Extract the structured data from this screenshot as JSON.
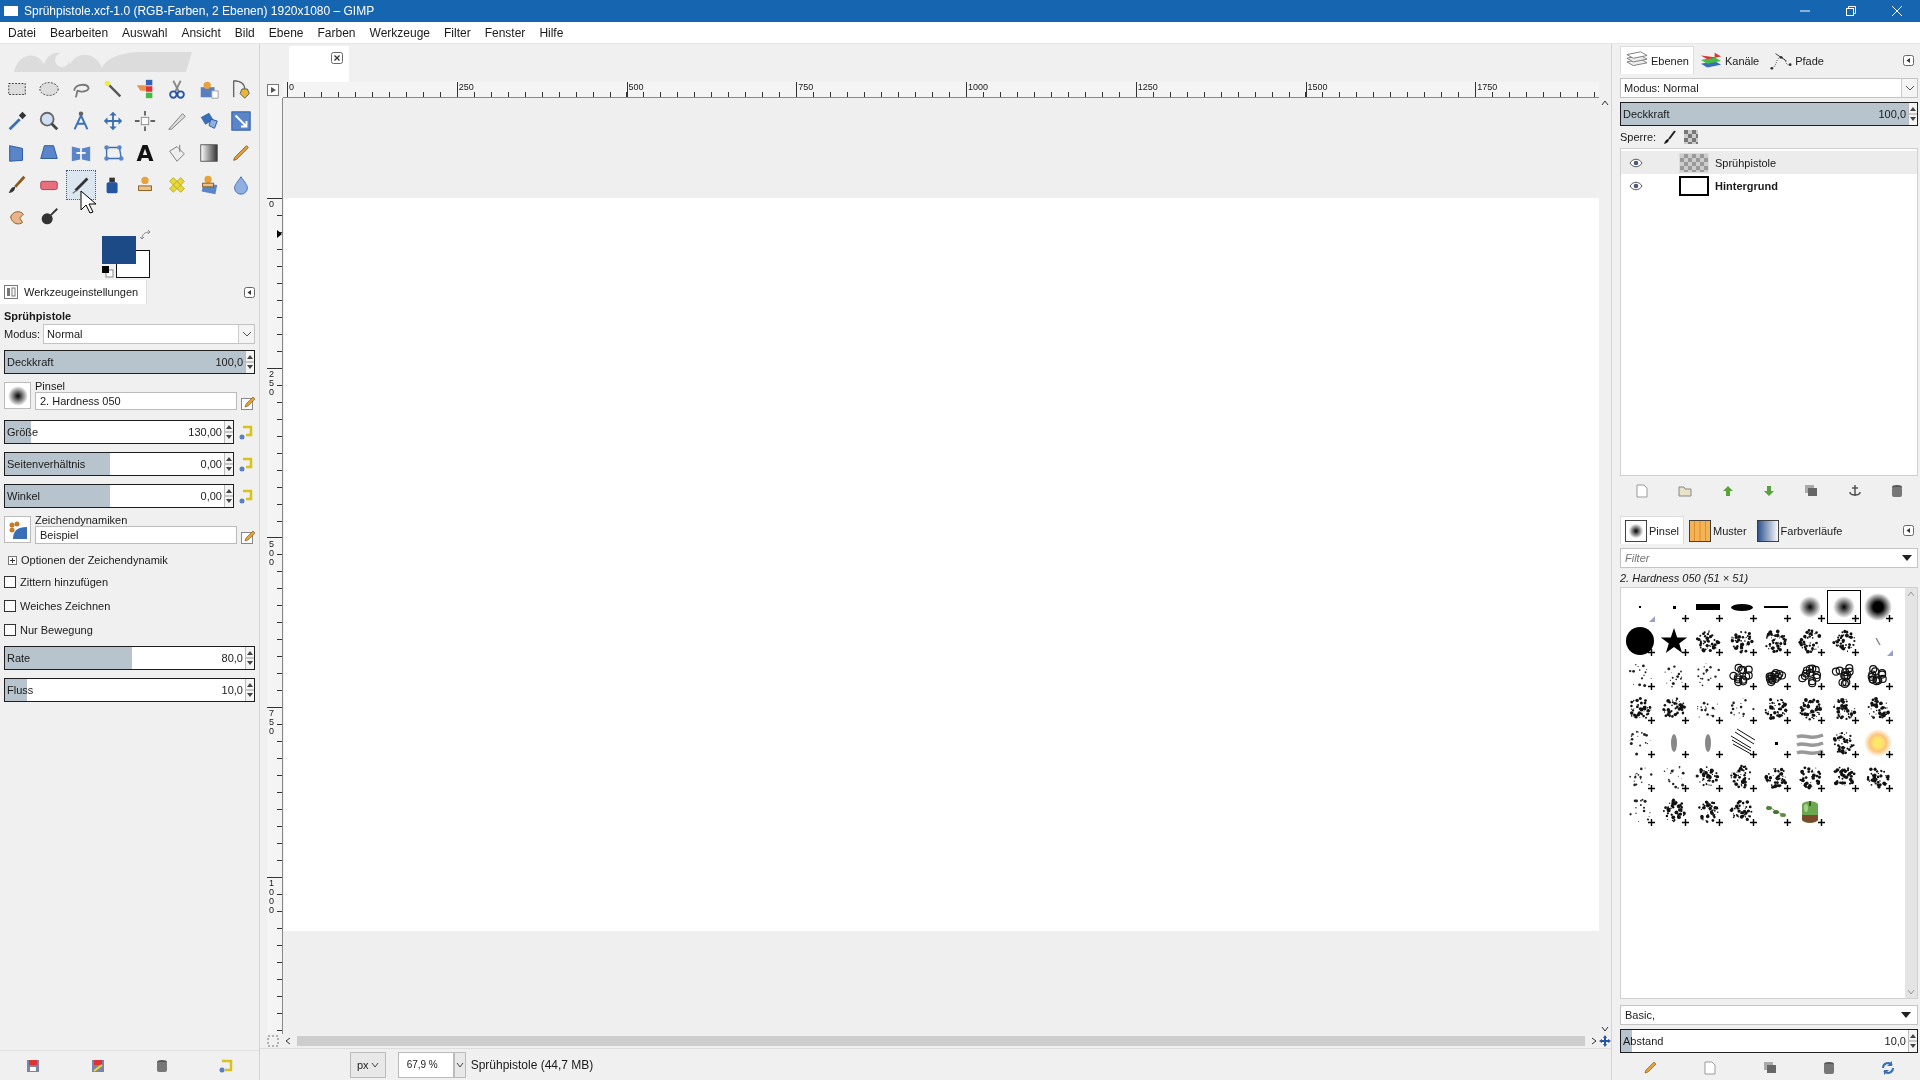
{
  "window": {
    "title": "Sprühpistole.xcf-1.0 (RGB-Farben, 2 Ebenen) 1920x1080 – GIMP"
  },
  "menu": [
    "Datei",
    "Bearbeiten",
    "Auswahl",
    "Ansicht",
    "Bild",
    "Ebene",
    "Farben",
    "Werkzeuge",
    "Filter",
    "Fenster",
    "Hilfe"
  ],
  "toolbox": {
    "tools": [
      {
        "kind": "rect_select",
        "selected": false
      },
      {
        "kind": "ellipse_select",
        "selected": false
      },
      {
        "kind": "lasso",
        "selected": false
      },
      {
        "kind": "wand",
        "selected": false
      },
      {
        "kind": "color_select",
        "selected": false
      },
      {
        "kind": "scissors",
        "selected": false
      },
      {
        "kind": "foreground_select",
        "selected": false
      },
      {
        "kind": "paths",
        "selected": false
      },
      {
        "kind": "eyedropper",
        "selected": false
      },
      {
        "kind": "zoom",
        "selected": false
      },
      {
        "kind": "measure",
        "selected": false
      },
      {
        "kind": "move",
        "selected": false
      },
      {
        "kind": "align",
        "selected": false
      },
      {
        "kind": "knife",
        "selected": false
      },
      {
        "kind": "transform",
        "selected": false
      },
      {
        "kind": "handle_transform",
        "selected": false
      },
      {
        "kind": "perspective",
        "selected": false
      },
      {
        "kind": "warp",
        "selected": false
      },
      {
        "kind": "flip",
        "selected": false
      },
      {
        "kind": "cage",
        "selected": false
      },
      {
        "kind": "text",
        "label": "A",
        "selected": false
      },
      {
        "kind": "bucket",
        "selected": false
      },
      {
        "kind": "gradient",
        "selected": false
      },
      {
        "kind": "pencil",
        "selected": false
      },
      {
        "kind": "paintbrush",
        "selected": false
      },
      {
        "kind": "eraser",
        "selected": false
      },
      {
        "kind": "airbrush",
        "selected": true
      },
      {
        "kind": "ink",
        "selected": false
      },
      {
        "kind": "clone",
        "selected": false
      },
      {
        "kind": "heal",
        "selected": false
      },
      {
        "kind": "perspective_clone",
        "selected": false
      },
      {
        "kind": "blur",
        "selected": false
      },
      {
        "kind": "smudge",
        "selected": false
      },
      {
        "kind": "dodge_burn",
        "selected": false
      }
    ]
  },
  "tool_options": {
    "tab": "Werkzeugeinstellungen",
    "tool": "Sprühpistole",
    "mode_label": "Modus:",
    "mode": "Normal",
    "opacity": {
      "label": "Deckkraft",
      "value": "100,0",
      "level": 1
    },
    "brush": {
      "label": "Pinsel",
      "value": "2. Hardness 050"
    },
    "sliders": [
      {
        "label": "Größe",
        "value": "130,00",
        "level": 0.12
      },
      {
        "label": "Seitenverhältnis",
        "value": "0,00",
        "level": 0.48
      },
      {
        "label": "Winkel",
        "value": "0,00",
        "level": 0.48
      }
    ],
    "dynamics": {
      "label": "Zeichendynamiken",
      "value": "Beispiel"
    },
    "dynamics_options": {
      "label": "Optionen der Zeichendynamik",
      "expanded": false
    },
    "checkboxes": [
      {
        "label": "Zittern hinzufügen",
        "checked": false
      },
      {
        "label": "Weiches Zeichnen",
        "checked": false
      },
      {
        "label": "Nur Bewegung",
        "checked": false
      }
    ],
    "rate_sliders": [
      {
        "label": "Rate",
        "value": "80,0",
        "level": 0.53
      },
      {
        "label": "Fluss",
        "value": "10,0",
        "level": 0.09
      }
    ]
  },
  "rulers": {
    "horizontal": [
      "0",
      "250",
      "500",
      "750",
      "1000",
      "1250",
      "1500",
      "1750"
    ],
    "vertical": [
      "0",
      "250",
      "500",
      "750",
      "1000"
    ]
  },
  "status_bar": {
    "unit": "px",
    "zoom": "67,9 %",
    "info": "Sprühpistole (44,7 MB)"
  },
  "layers_dock": {
    "tabs": [
      {
        "label": "Ebenen",
        "selected": true
      },
      {
        "label": "Kanäle",
        "selected": false
      },
      {
        "label": "Pfade",
        "selected": false
      }
    ],
    "mode": "Modus: Normal",
    "opacity": {
      "label": "Deckkraft",
      "value": "100,0",
      "level": 1
    },
    "lock_label": "Sperre:",
    "layers": [
      {
        "name": "Sprühpistole",
        "visible": true,
        "alpha": true,
        "selected": true
      },
      {
        "name": "Hintergrund",
        "visible": true,
        "alpha": false,
        "selected": false
      }
    ]
  },
  "brushes_dock": {
    "tabs": [
      {
        "label": "Pinsel",
        "selected": true
      },
      {
        "label": "Muster",
        "selected": false
      },
      {
        "label": "Farbverläufe",
        "selected": false
      }
    ],
    "filter_placeholder": "Filter",
    "current": "2. Hardness 050 (51 × 51)",
    "brushes": [
      {
        "kind": "pixel",
        "selected": false
      },
      {
        "kind": "dot",
        "selected": false
      },
      {
        "kind": "bar",
        "selected": false
      },
      {
        "kind": "ellipse",
        "selected": false
      },
      {
        "kind": "line",
        "selected": false
      },
      {
        "kind": "soft",
        "selected": false
      },
      {
        "kind": "soft",
        "selected": true
      },
      {
        "kind": "soft_large",
        "selected": false
      },
      {
        "kind": "disc",
        "selected": false
      },
      {
        "kind": "star",
        "selected": false
      },
      {
        "kind": "splatter",
        "selected": false
      },
      {
        "kind": "splatter",
        "selected": false
      },
      {
        "kind": "splatter",
        "selected": false
      },
      {
        "kind": "splatter",
        "selected": false
      },
      {
        "kind": "splatter",
        "selected": false
      },
      {
        "kind": "stroke",
        "selected": false
      },
      {
        "kind": "sparse",
        "selected": false
      },
      {
        "kind": "sparse",
        "selected": false
      },
      {
        "kind": "sparse",
        "selected": false
      },
      {
        "kind": "texture",
        "selected": false
      },
      {
        "kind": "texture",
        "selected": false
      },
      {
        "kind": "texture",
        "selected": false
      },
      {
        "kind": "texture",
        "selected": false
      },
      {
        "kind": "texture",
        "selected": false
      },
      {
        "kind": "splatter",
        "selected": false
      },
      {
        "kind": "splatter",
        "selected": false
      },
      {
        "kind": "sparse",
        "selected": false
      },
      {
        "kind": "sparse",
        "selected": false
      },
      {
        "kind": "splatter",
        "selected": false
      },
      {
        "kind": "splatter",
        "selected": false
      },
      {
        "kind": "splatter",
        "selected": false
      },
      {
        "kind": "splatter",
        "selected": false
      },
      {
        "kind": "sparse",
        "selected": false
      },
      {
        "kind": "smudge",
        "selected": false
      },
      {
        "kind": "smudge",
        "selected": false
      },
      {
        "kind": "hatch",
        "selected": false
      },
      {
        "kind": "dot",
        "selected": false
      },
      {
        "kind": "stripes",
        "selected": false
      },
      {
        "kind": "splatter",
        "selected": false
      },
      {
        "kind": "glow",
        "selected": false
      },
      {
        "kind": "sparse",
        "selected": false
      },
      {
        "kind": "sparse",
        "selected": false
      },
      {
        "kind": "splatter",
        "selected": false
      },
      {
        "kind": "splatter",
        "selected": false
      },
      {
        "kind": "splatter",
        "selected": false
      },
      {
        "kind": "splatter",
        "selected": false
      },
      {
        "kind": "splatter",
        "selected": false
      },
      {
        "kind": "splatter",
        "selected": false
      },
      {
        "kind": "sparse",
        "selected": false
      },
      {
        "kind": "splatter",
        "selected": false
      },
      {
        "kind": "splatter",
        "selected": false
      },
      {
        "kind": "splatter",
        "selected": false
      },
      {
        "kind": "leaves",
        "selected": false
      },
      {
        "kind": "picture",
        "selected": false
      }
    ],
    "preset": "Basic,",
    "spacing": {
      "label": "Abstand",
      "value": "10,0",
      "level": 0.04
    }
  }
}
